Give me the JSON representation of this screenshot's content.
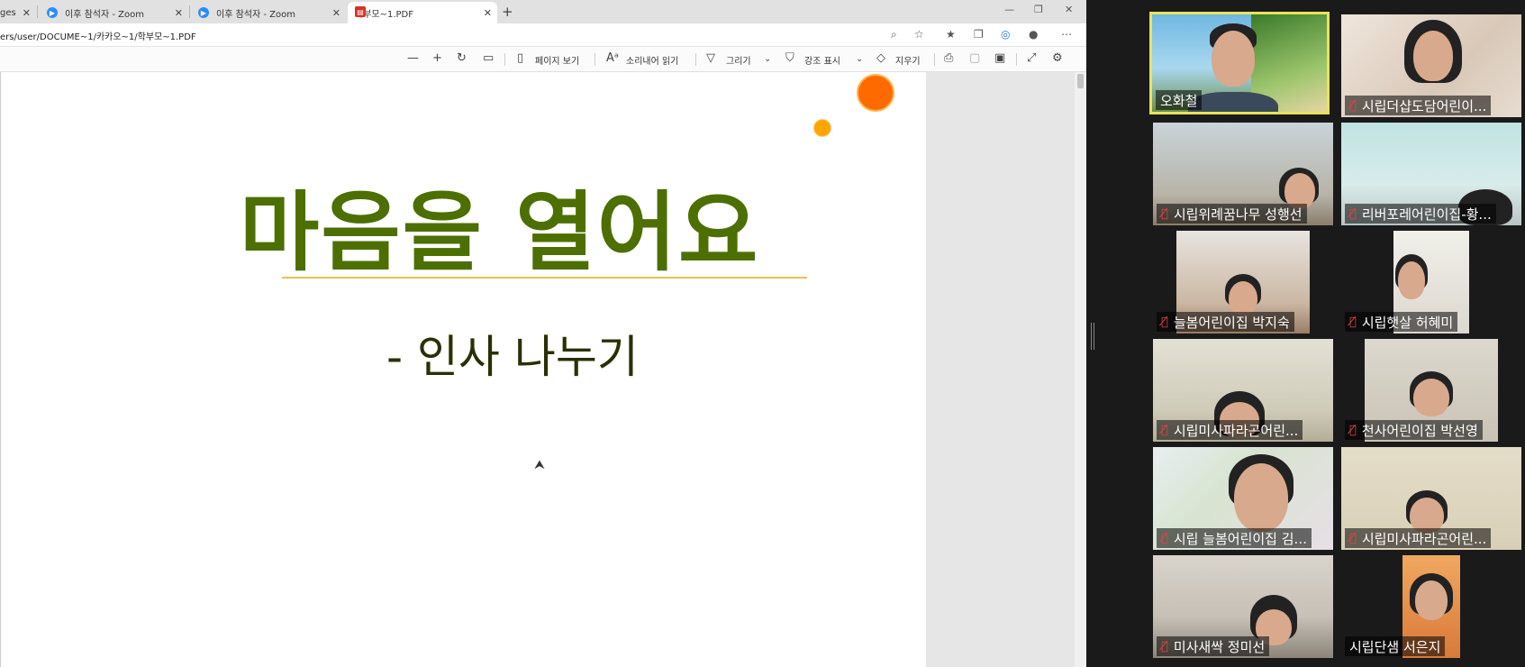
{
  "browser": {
    "tabs": [
      {
        "title": "ges",
        "icon": "none"
      },
      {
        "title": "이후 참석자 - Zoom",
        "icon": "zoom-icon"
      },
      {
        "title": "이후 참석자 - Zoom",
        "icon": "zoom-icon"
      },
      {
        "title": "학부모~1.PDF",
        "icon": "pdf-icon"
      }
    ],
    "new_tab": "+",
    "window_controls": [
      "—",
      "❐",
      "✕"
    ],
    "address": "ers/user/DOCUME~1/카카오~1/학부모~1.PDF"
  },
  "pdf_toolbar": {
    "zoom_out": "—",
    "zoom_in": "+",
    "page_view": "페이지 보기",
    "read_aloud": "소리내어 읽기",
    "draw": "그리기",
    "highlight": "강조 표시",
    "erase": "지우기"
  },
  "slide": {
    "title": "마음을 열어요",
    "subtitle": "-  인사 나누기",
    "accent_orange": "#ff6a00",
    "title_color": "#4c6f00"
  },
  "participants": [
    {
      "name": "오화철",
      "muted": false,
      "speaker": true
    },
    {
      "name": "시립더샵도담어린이...",
      "muted": true
    },
    {
      "name": "시립위례꿈나무 성행선",
      "muted": true
    },
    {
      "name": "리버포레어린이집-황...",
      "muted": true
    },
    {
      "name": "늘봄어린이집 박지숙",
      "muted": true
    },
    {
      "name": "시립햇살 허혜미",
      "muted": true
    },
    {
      "name": "시립미사파라곤어린...",
      "muted": true
    },
    {
      "name": "천사어린이집 박선영",
      "muted": true
    },
    {
      "name": "시립 늘봄어린이집 김...",
      "muted": true
    },
    {
      "name": "시립미사파라곤어린...",
      "muted": true
    },
    {
      "name": "미사새싹 정미선",
      "muted": true
    },
    {
      "name": "시립단샘 서은지",
      "muted": false
    }
  ]
}
